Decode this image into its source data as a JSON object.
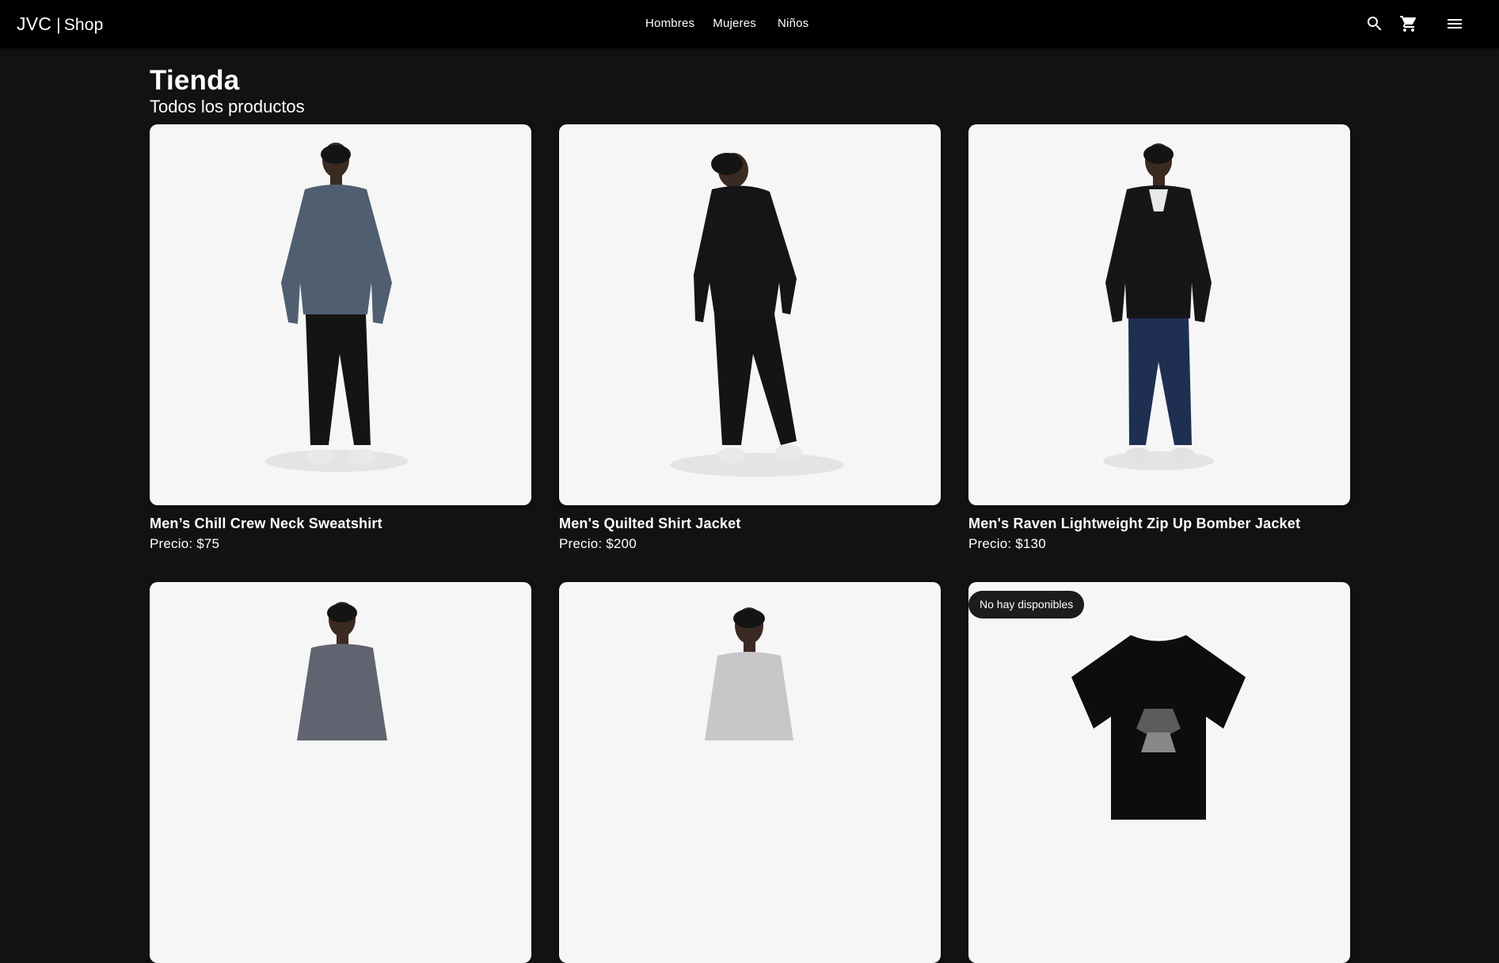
{
  "header": {
    "brand_main": "JVC",
    "brand_sep": "|",
    "brand_sub": "Shop",
    "nav": [
      {
        "label": "Hombres"
      },
      {
        "label": "Mujeres"
      },
      {
        "label": "Niños"
      }
    ],
    "icons": {
      "search": "search-icon",
      "cart": "cart-icon",
      "menu": "menu-icon"
    }
  },
  "page": {
    "title": "Tienda",
    "subtitle": "Todos los productos"
  },
  "products": [
    {
      "name": "Men’s Chill Crew Neck Sweatshirt",
      "price": "Precio: $75",
      "top_color": "#4f5f70",
      "pants_color": "#141414"
    },
    {
      "name": "Men's Quilted Shirt Jacket",
      "price": "Precio: $200",
      "top_color": "#151515",
      "pants_color": "#141414"
    },
    {
      "name": "Men's Raven Lightweight Zip Up Bomber Jacket",
      "price": "Precio: $130",
      "top_color": "#161616",
      "pants_color": "#1f2f52"
    },
    {
      "name": "",
      "price": "",
      "top_color": "#606470",
      "pants_color": "#141414"
    },
    {
      "name": "",
      "price": "",
      "top_color": "#c9c6c9",
      "pants_color": "#141414"
    },
    {
      "name": "",
      "price": "",
      "badge": "No hay disponibles",
      "top_color": "#0d0d0d"
    }
  ],
  "colors": {
    "background": "#121212",
    "header": "#000000",
    "card": "#f6f6f6",
    "text": "#ffffff"
  }
}
